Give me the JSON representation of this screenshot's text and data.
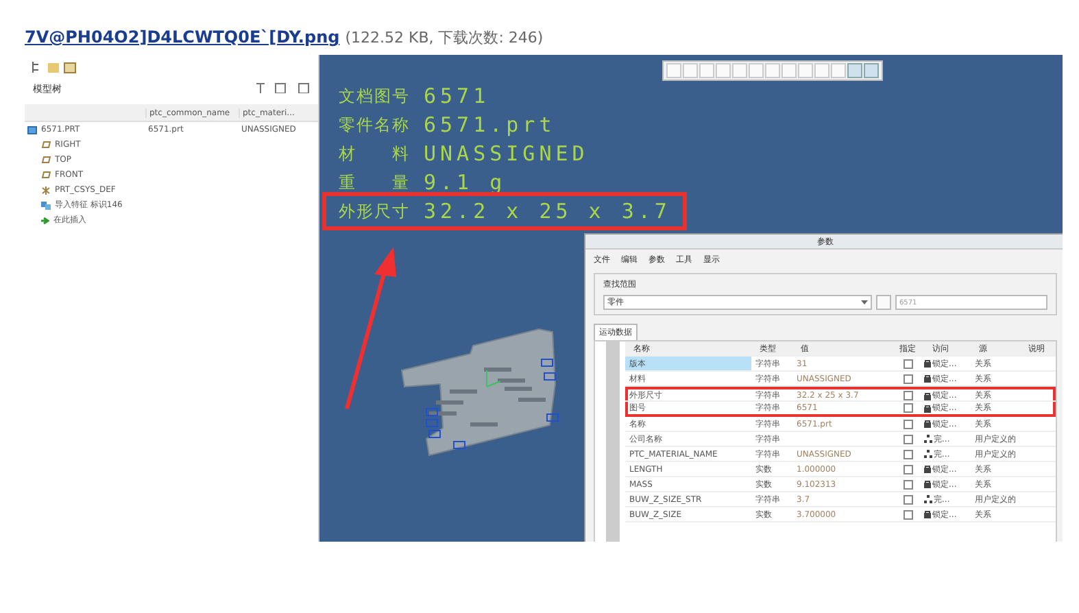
{
  "attachment": {
    "filename": "7V@PH04O2]D4LCWTQ0E`[DY.png",
    "meta": "(122.52 KB, 下载次数: 246)"
  },
  "model_tree": {
    "title": "模型树",
    "columns": [
      "ptc_common_name",
      "ptc_materi..."
    ],
    "items": [
      {
        "kind": "part",
        "label": "6571.PRT",
        "values": [
          "6571.prt",
          "UNASSIGNED"
        ]
      },
      {
        "kind": "plane",
        "label": "RIGHT"
      },
      {
        "kind": "plane",
        "label": "TOP"
      },
      {
        "kind": "plane",
        "label": "FRONT"
      },
      {
        "kind": "csys",
        "label": "PRT_CSYS_DEF"
      },
      {
        "kind": "import",
        "label": "导入特征 标识146"
      },
      {
        "kind": "insert",
        "label": "在此插入"
      }
    ]
  },
  "viewport": {
    "info": [
      {
        "label": "文档图号",
        "value": "6571",
        "highlighted": false
      },
      {
        "label": "零件名称",
        "value": "6571.prt",
        "highlighted": false
      },
      {
        "label": "材　　料",
        "value": "UNASSIGNED",
        "highlighted": false
      },
      {
        "label": "重　　量",
        "value": "9.1 g",
        "highlighted": false
      },
      {
        "label": "外形尺寸",
        "value": "32.2 x 25 x 3.7",
        "highlighted": true
      }
    ]
  },
  "parameters_dialog": {
    "title": "参数",
    "menu": [
      "文件",
      "编辑",
      "参数",
      "工具",
      "显示"
    ],
    "lookup_group": "查找范围",
    "lookup_type": "零件",
    "lookup_model": "6571",
    "tab": "运动数据",
    "columns": [
      "名称",
      "类型",
      "值",
      "指定",
      "访问",
      "源",
      "说明"
    ],
    "rows": [
      {
        "name": "版本",
        "type": "字符串",
        "value": "31",
        "specified": false,
        "access": {
          "kind": "lock",
          "label": "锁定..."
        },
        "source": "关系",
        "selected": true,
        "highlighted": false
      },
      {
        "name": "材料",
        "type": "字符串",
        "value": "UNASSIGNED",
        "specified": false,
        "access": {
          "kind": "lock",
          "label": "锁定..."
        },
        "source": "关系",
        "selected": false,
        "highlighted": false
      },
      {
        "name": "外形尺寸",
        "type": "字符串",
        "value": "32.2 x 25 x 3.7",
        "specified": false,
        "access": {
          "kind": "lock",
          "label": "锁定..."
        },
        "source": "关系",
        "selected": false,
        "highlighted": true
      },
      {
        "name": "图号",
        "type": "字符串",
        "value": "6571",
        "specified": false,
        "access": {
          "kind": "lock",
          "label": "锁定..."
        },
        "source": "关系",
        "selected": false,
        "highlighted": true
      },
      {
        "name": "名称",
        "type": "字符串",
        "value": "6571.prt",
        "specified": false,
        "access": {
          "kind": "lock",
          "label": "锁定..."
        },
        "source": "关系",
        "selected": false,
        "highlighted": false
      },
      {
        "name": "公司名称",
        "type": "字符串",
        "specified": false,
        "access": {
          "kind": "net",
          "label": "完..."
        },
        "source": "用户定义的",
        "selected": false,
        "highlighted": false
      },
      {
        "name": "PTC_MATERIAL_NAME",
        "type": "字符串",
        "value": "UNASSIGNED",
        "specified": false,
        "access": {
          "kind": "net",
          "label": "完..."
        },
        "source": "用户定义的",
        "selected": false,
        "highlighted": false
      },
      {
        "name": "LENGTH",
        "type": "实数",
        "value": "1.000000",
        "specified": false,
        "access": {
          "kind": "lock",
          "label": "锁定..."
        },
        "source": "关系",
        "selected": false,
        "highlighted": false
      },
      {
        "name": "MASS",
        "type": "实数",
        "value": "9.102313",
        "specified": false,
        "access": {
          "kind": "lock",
          "label": "锁定..."
        },
        "source": "关系",
        "selected": false,
        "highlighted": false
      },
      {
        "name": "BUW_Z_SIZE_STR",
        "type": "字符串",
        "value": "3.7",
        "specified": false,
        "access": {
          "kind": "net",
          "label": "完..."
        },
        "source": "用户定义的",
        "selected": false,
        "highlighted": false
      },
      {
        "name": "BUW_Z_SIZE",
        "type": "实数",
        "value": "3.700000",
        "specified": false,
        "access": {
          "kind": "lock",
          "label": "锁定..."
        },
        "source": "关系",
        "selected": false,
        "highlighted": false
      }
    ]
  }
}
